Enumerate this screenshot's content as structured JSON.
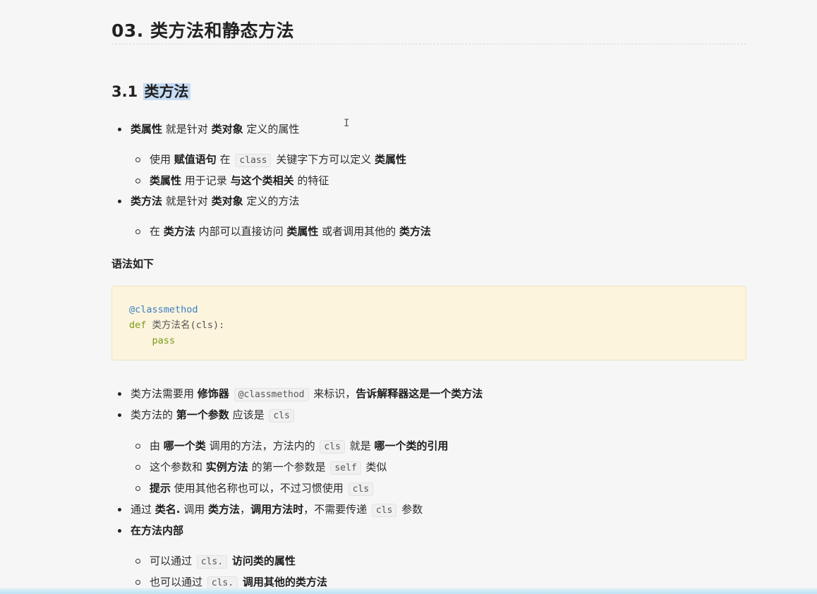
{
  "title": "03. 类方法和静态方法",
  "section": {
    "number": "3.1",
    "title": "类方法"
  },
  "list1": [
    {
      "parts": [
        [
          "b",
          "类属性"
        ],
        [
          "t",
          " 就是针对 "
        ],
        [
          "b",
          "类对象"
        ],
        [
          "t",
          " 定义的属性"
        ]
      ],
      "children": [
        [
          [
            "t",
            "使用 "
          ],
          [
            "b",
            "赋值语句"
          ],
          [
            "t",
            " 在 "
          ],
          [
            "c",
            "class"
          ],
          [
            "t",
            " 关键字下方可以定义 "
          ],
          [
            "b",
            "类属性"
          ]
        ],
        [
          [
            "b",
            "类属性"
          ],
          [
            "t",
            " 用于记录 "
          ],
          [
            "b",
            "与这个类相关"
          ],
          [
            "t",
            " 的特征"
          ]
        ]
      ]
    },
    {
      "parts": [
        [
          "b",
          "类方法"
        ],
        [
          "t",
          " 就是针对 "
        ],
        [
          "b",
          "类对象"
        ],
        [
          "t",
          " 定义的方法"
        ]
      ],
      "children": [
        [
          [
            "t",
            "在 "
          ],
          [
            "b",
            "类方法"
          ],
          [
            "t",
            " 内部可以直接访问 "
          ],
          [
            "b",
            "类属性"
          ],
          [
            "t",
            " 或者调用其他的 "
          ],
          [
            "b",
            "类方法"
          ]
        ]
      ]
    }
  ],
  "syntax_label": "语法如下",
  "code": {
    "decorator": "@classmethod",
    "def_kw": "def",
    "def_rest": " 类方法名(cls):",
    "pass_kw": "pass"
  },
  "list2": [
    {
      "parts": [
        [
          "t",
          "类方法需要用 "
        ],
        [
          "b",
          "修饰器"
        ],
        [
          "t",
          " "
        ],
        [
          "c",
          "@classmethod"
        ],
        [
          "t",
          " 来标识，"
        ],
        [
          "b",
          "告诉解释器这是一个类方法"
        ]
      ],
      "children": []
    },
    {
      "parts": [
        [
          "t",
          "类方法的 "
        ],
        [
          "b",
          "第一个参数"
        ],
        [
          "t",
          " 应该是 "
        ],
        [
          "c",
          "cls"
        ]
      ],
      "children": [
        [
          [
            "t",
            "由 "
          ],
          [
            "b",
            "哪一个类"
          ],
          [
            "t",
            " 调用的方法，方法内的 "
          ],
          [
            "c",
            "cls"
          ],
          [
            "t",
            " 就是 "
          ],
          [
            "b",
            "哪一个类的引用"
          ]
        ],
        [
          [
            "t",
            "这个参数和 "
          ],
          [
            "b",
            "实例方法"
          ],
          [
            "t",
            " 的第一个参数是 "
          ],
          [
            "c",
            "self"
          ],
          [
            "t",
            " 类似"
          ]
        ],
        [
          [
            "b",
            "提示"
          ],
          [
            "t",
            " 使用其他名称也可以，不过习惯使用 "
          ],
          [
            "c",
            "cls"
          ]
        ]
      ]
    },
    {
      "parts": [
        [
          "t",
          "通过 "
        ],
        [
          "b",
          "类名."
        ],
        [
          "t",
          " 调用 "
        ],
        [
          "b",
          "类方法"
        ],
        [
          "t",
          "，"
        ],
        [
          "b",
          "调用方法时"
        ],
        [
          "t",
          "，不需要传递 "
        ],
        [
          "c",
          "cls"
        ],
        [
          "t",
          " 参数"
        ]
      ],
      "children": []
    },
    {
      "parts": [
        [
          "b",
          "在方法内部"
        ]
      ],
      "children": [
        [
          [
            "t",
            "可以通过 "
          ],
          [
            "c",
            "cls."
          ],
          [
            "t",
            " "
          ],
          [
            "b",
            "访问类的属性"
          ]
        ],
        [
          [
            "t",
            "也可以通过 "
          ],
          [
            "c",
            "cls."
          ],
          [
            "t",
            " "
          ],
          [
            "b",
            "调用其他的类方法"
          ]
        ]
      ]
    }
  ]
}
